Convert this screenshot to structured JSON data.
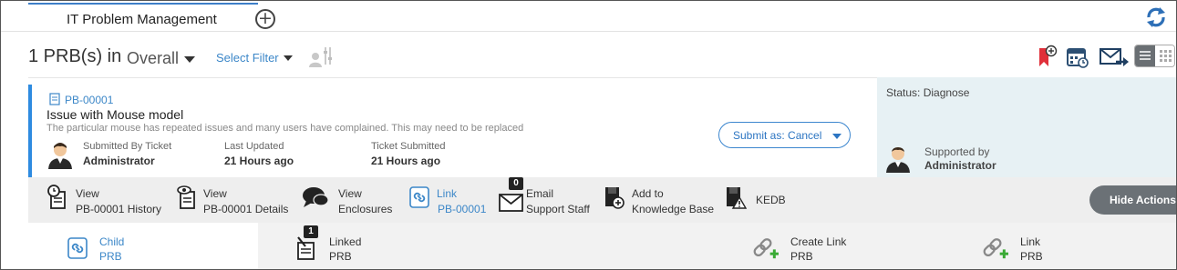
{
  "tabs": {
    "active_label": "IT Problem Management"
  },
  "header": {
    "count_label": "1 PRB(s) in",
    "scope_label": "Overall",
    "select_filter_label": "Select Filter"
  },
  "problem": {
    "id": "PB-00001",
    "title": "Issue with Mouse model",
    "description": "The particular mouse has repeated issues and many users have complained. This may need to be replaced",
    "submitted_by_label": "Submitted By Ticket",
    "submitted_by_value": "Administrator",
    "last_updated_label": "Last Updated",
    "last_updated_value": "21 Hours ago",
    "ticket_submitted_label": "Ticket Submitted",
    "ticket_submitted_value": "21 Hours ago",
    "submit_button_label": "Submit as: Cancel"
  },
  "status_panel": {
    "status_text": "Status: Diagnose",
    "supported_by_label": "Supported by",
    "supported_by_value": "Administrator"
  },
  "actions": {
    "items": [
      {
        "line1": "View",
        "line2": "PB-00001 History"
      },
      {
        "line1": "View",
        "line2": "PB-00001 Details"
      },
      {
        "line1": "View",
        "line2": "Enclosures"
      },
      {
        "line1": "Link",
        "line2": "PB-00001"
      },
      {
        "line1": "Email",
        "line2": "Support Staff",
        "badge": "0"
      },
      {
        "line1": "Add to",
        "line2": "Knowledge Base"
      },
      {
        "line1": "KEDB",
        "line2": ""
      }
    ],
    "hide_label": "Hide Actions"
  },
  "bottom_tabs": [
    {
      "line1": "Child",
      "line2": "PRB"
    },
    {
      "line1": "Linked",
      "line2": "PRB",
      "badge": "1"
    },
    {
      "line1": "Create Link",
      "line2": "PRB"
    },
    {
      "line1": "Link",
      "line2": "PRB"
    }
  ],
  "colors": {
    "accent_blue": "#3c87c8",
    "action_bar_bg": "#eeeeee",
    "status_panel_bg": "#e7f1f4",
    "hide_actions_bg": "#6b7176",
    "link_add_green": "#3aaa35"
  }
}
